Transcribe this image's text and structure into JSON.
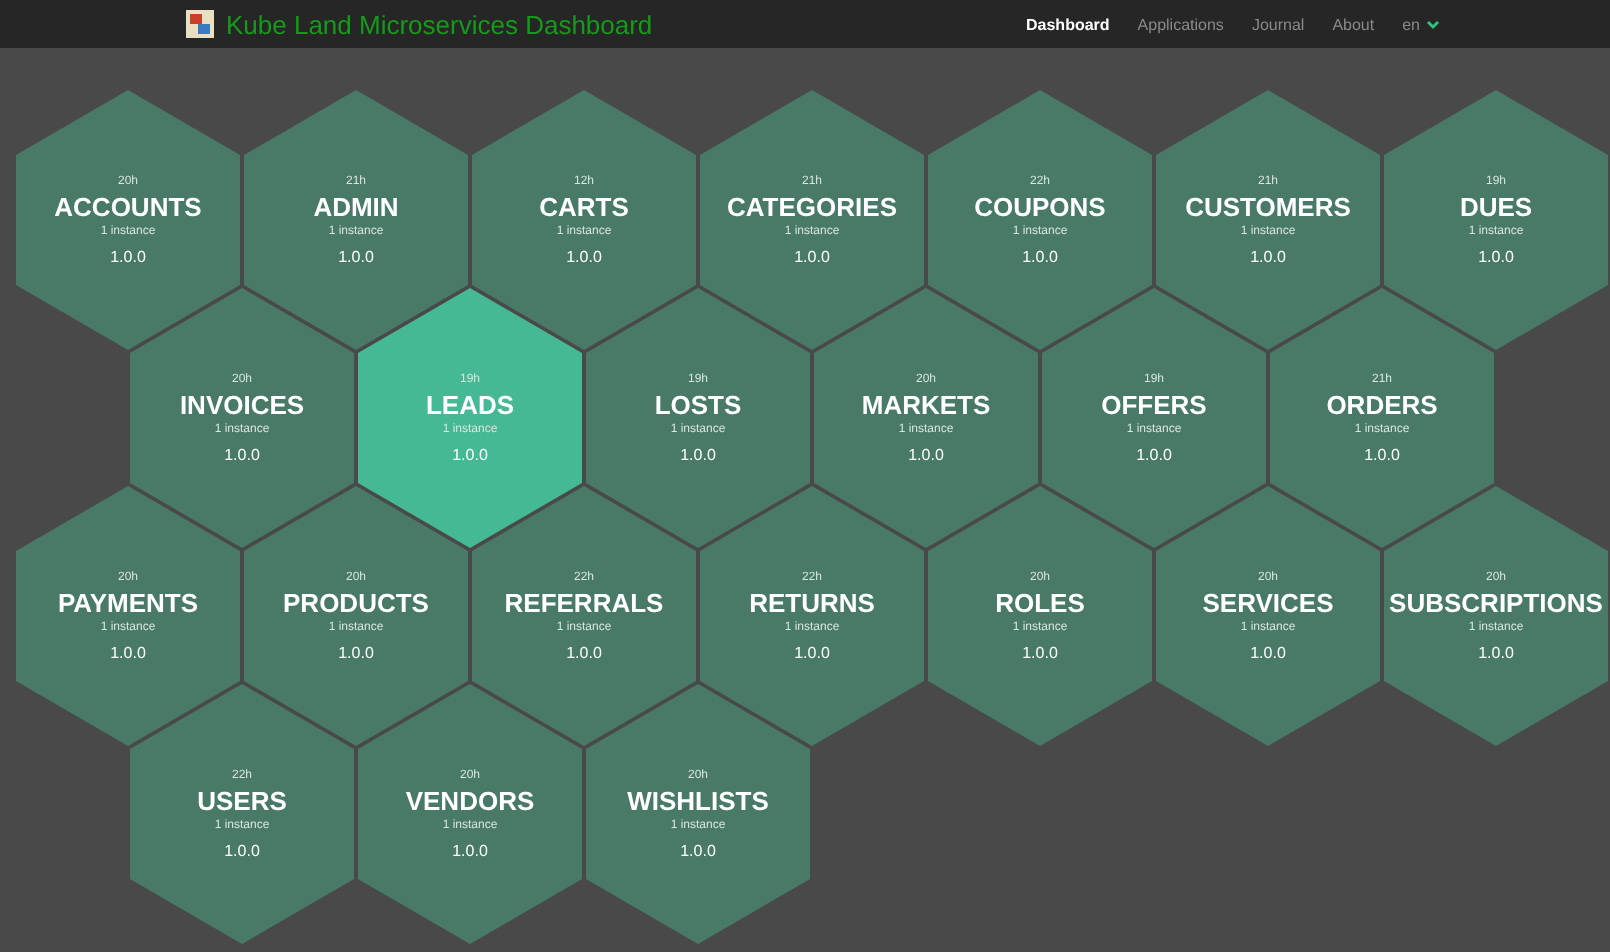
{
  "header": {
    "title": "Kube Land Microservices Dashboard",
    "nav": [
      {
        "label": "Dashboard",
        "selected": true
      },
      {
        "label": "Applications",
        "selected": false
      },
      {
        "label": "Journal",
        "selected": false
      },
      {
        "label": "About",
        "selected": false
      }
    ],
    "language": "en"
  },
  "rows": [
    [
      {
        "name": "ACCOUNTS",
        "age": "20h",
        "instances": "1 instance",
        "version": "1.0.0",
        "selected": false
      },
      {
        "name": "ADMIN",
        "age": "21h",
        "instances": "1 instance",
        "version": "1.0.0",
        "selected": false
      },
      {
        "name": "CARTS",
        "age": "12h",
        "instances": "1 instance",
        "version": "1.0.0",
        "selected": false
      },
      {
        "name": "CATEGORIES",
        "age": "21h",
        "instances": "1 instance",
        "version": "1.0.0",
        "selected": false
      },
      {
        "name": "COUPONS",
        "age": "22h",
        "instances": "1 instance",
        "version": "1.0.0",
        "selected": false
      },
      {
        "name": "CUSTOMERS",
        "age": "21h",
        "instances": "1 instance",
        "version": "1.0.0",
        "selected": false
      },
      {
        "name": "DUES",
        "age": "19h",
        "instances": "1 instance",
        "version": "1.0.0",
        "selected": false
      }
    ],
    [
      {
        "name": "INVOICES",
        "age": "20h",
        "instances": "1 instance",
        "version": "1.0.0",
        "selected": false
      },
      {
        "name": "LEADS",
        "age": "19h",
        "instances": "1 instance",
        "version": "1.0.0",
        "selected": true
      },
      {
        "name": "LOSTS",
        "age": "19h",
        "instances": "1 instance",
        "version": "1.0.0",
        "selected": false
      },
      {
        "name": "MARKETS",
        "age": "20h",
        "instances": "1 instance",
        "version": "1.0.0",
        "selected": false
      },
      {
        "name": "OFFERS",
        "age": "19h",
        "instances": "1 instance",
        "version": "1.0.0",
        "selected": false
      },
      {
        "name": "ORDERS",
        "age": "21h",
        "instances": "1 instance",
        "version": "1.0.0",
        "selected": false
      }
    ],
    [
      {
        "name": "PAYMENTS",
        "age": "20h",
        "instances": "1 instance",
        "version": "1.0.0",
        "selected": false
      },
      {
        "name": "PRODUCTS",
        "age": "20h",
        "instances": "1 instance",
        "version": "1.0.0",
        "selected": false
      },
      {
        "name": "REFERRALS",
        "age": "22h",
        "instances": "1 instance",
        "version": "1.0.0",
        "selected": false
      },
      {
        "name": "RETURNS",
        "age": "22h",
        "instances": "1 instance",
        "version": "1.0.0",
        "selected": false
      },
      {
        "name": "ROLES",
        "age": "20h",
        "instances": "1 instance",
        "version": "1.0.0",
        "selected": false
      },
      {
        "name": "SERVICES",
        "age": "20h",
        "instances": "1 instance",
        "version": "1.0.0",
        "selected": false
      },
      {
        "name": "SUBSCRIPTIONS",
        "age": "20h",
        "instances": "1 instance",
        "version": "1.0.0",
        "selected": false
      }
    ],
    [
      {
        "name": "USERS",
        "age": "22h",
        "instances": "1 instance",
        "version": "1.0.0",
        "selected": false
      },
      {
        "name": "VENDORS",
        "age": "20h",
        "instances": "1 instance",
        "version": "1.0.0",
        "selected": false
      },
      {
        "name": "WISHLISTS",
        "age": "20h",
        "instances": "1 instance",
        "version": "1.0.0",
        "selected": false
      }
    ]
  ]
}
